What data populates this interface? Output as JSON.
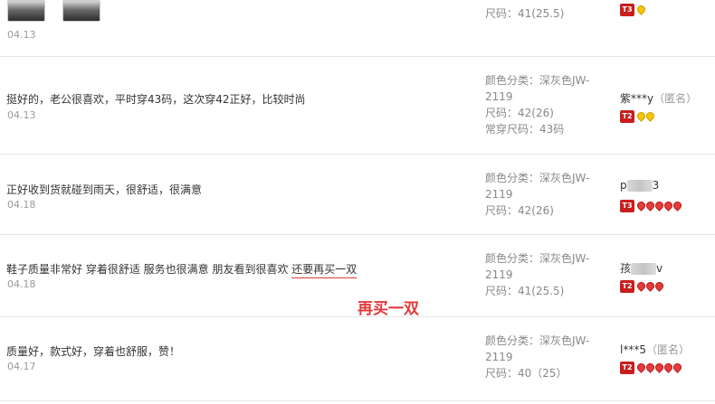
{
  "reviews": [
    {
      "text": "",
      "date": "04.13",
      "sku": [
        {
          "label": "尺码：41(25.5)"
        }
      ],
      "user": {
        "name": "",
        "anon": "",
        "level": "T3",
        "gems": [
          "gold"
        ]
      }
    },
    {
      "text": "挺好的，老公很喜欢，平时穿43码，这次穿42正好，比较时尚",
      "date": "04.13",
      "sku": [
        {
          "label": "颜色分类：深灰色JW-2119"
        },
        {
          "label": "尺码：42(26)"
        },
        {
          "label": "常穿尺码：43码"
        }
      ],
      "user": {
        "name": "紫***y",
        "anon": "（匿名）",
        "level": "T2",
        "gems": [
          "gold",
          "gold"
        ]
      }
    },
    {
      "text": "正好收到货就碰到雨天，很舒适，很满意",
      "date": "04.18",
      "sku": [
        {
          "label": "颜色分类：深灰色JW-2119"
        },
        {
          "label": "尺码：42(26)"
        }
      ],
      "user": {
        "name_prefix": "p",
        "name_suffix": "3",
        "anon": "",
        "level": "T3",
        "gems": [
          "red",
          "red",
          "red",
          "red",
          "red"
        ]
      }
    },
    {
      "text_main": "鞋子质量非常好 穿着很舒适 服务也很满意 朋友看到很喜欢 ",
      "text_highlight": "还要再买一双",
      "date": "04.18",
      "sku": [
        {
          "label": "颜色分类：深灰色JW-2119"
        },
        {
          "label": "尺码：41(25.5)"
        }
      ],
      "user": {
        "name_prefix": "孩",
        "name_suffix": "v",
        "anon": "",
        "level": "T2",
        "gems": [
          "red",
          "red",
          "red"
        ]
      }
    },
    {
      "text": "质量好，款式好，穿着也舒服，赞！",
      "date": "04.17",
      "sku": [
        {
          "label": "颜色分类：深灰色JW-2119"
        },
        {
          "label": "尺码：40（25）"
        }
      ],
      "user": {
        "name": "l***5",
        "anon": "（匿名）",
        "level": "T2",
        "gems": [
          "red",
          "red",
          "red",
          "red",
          "red"
        ]
      }
    }
  ],
  "callout": "再买一双"
}
